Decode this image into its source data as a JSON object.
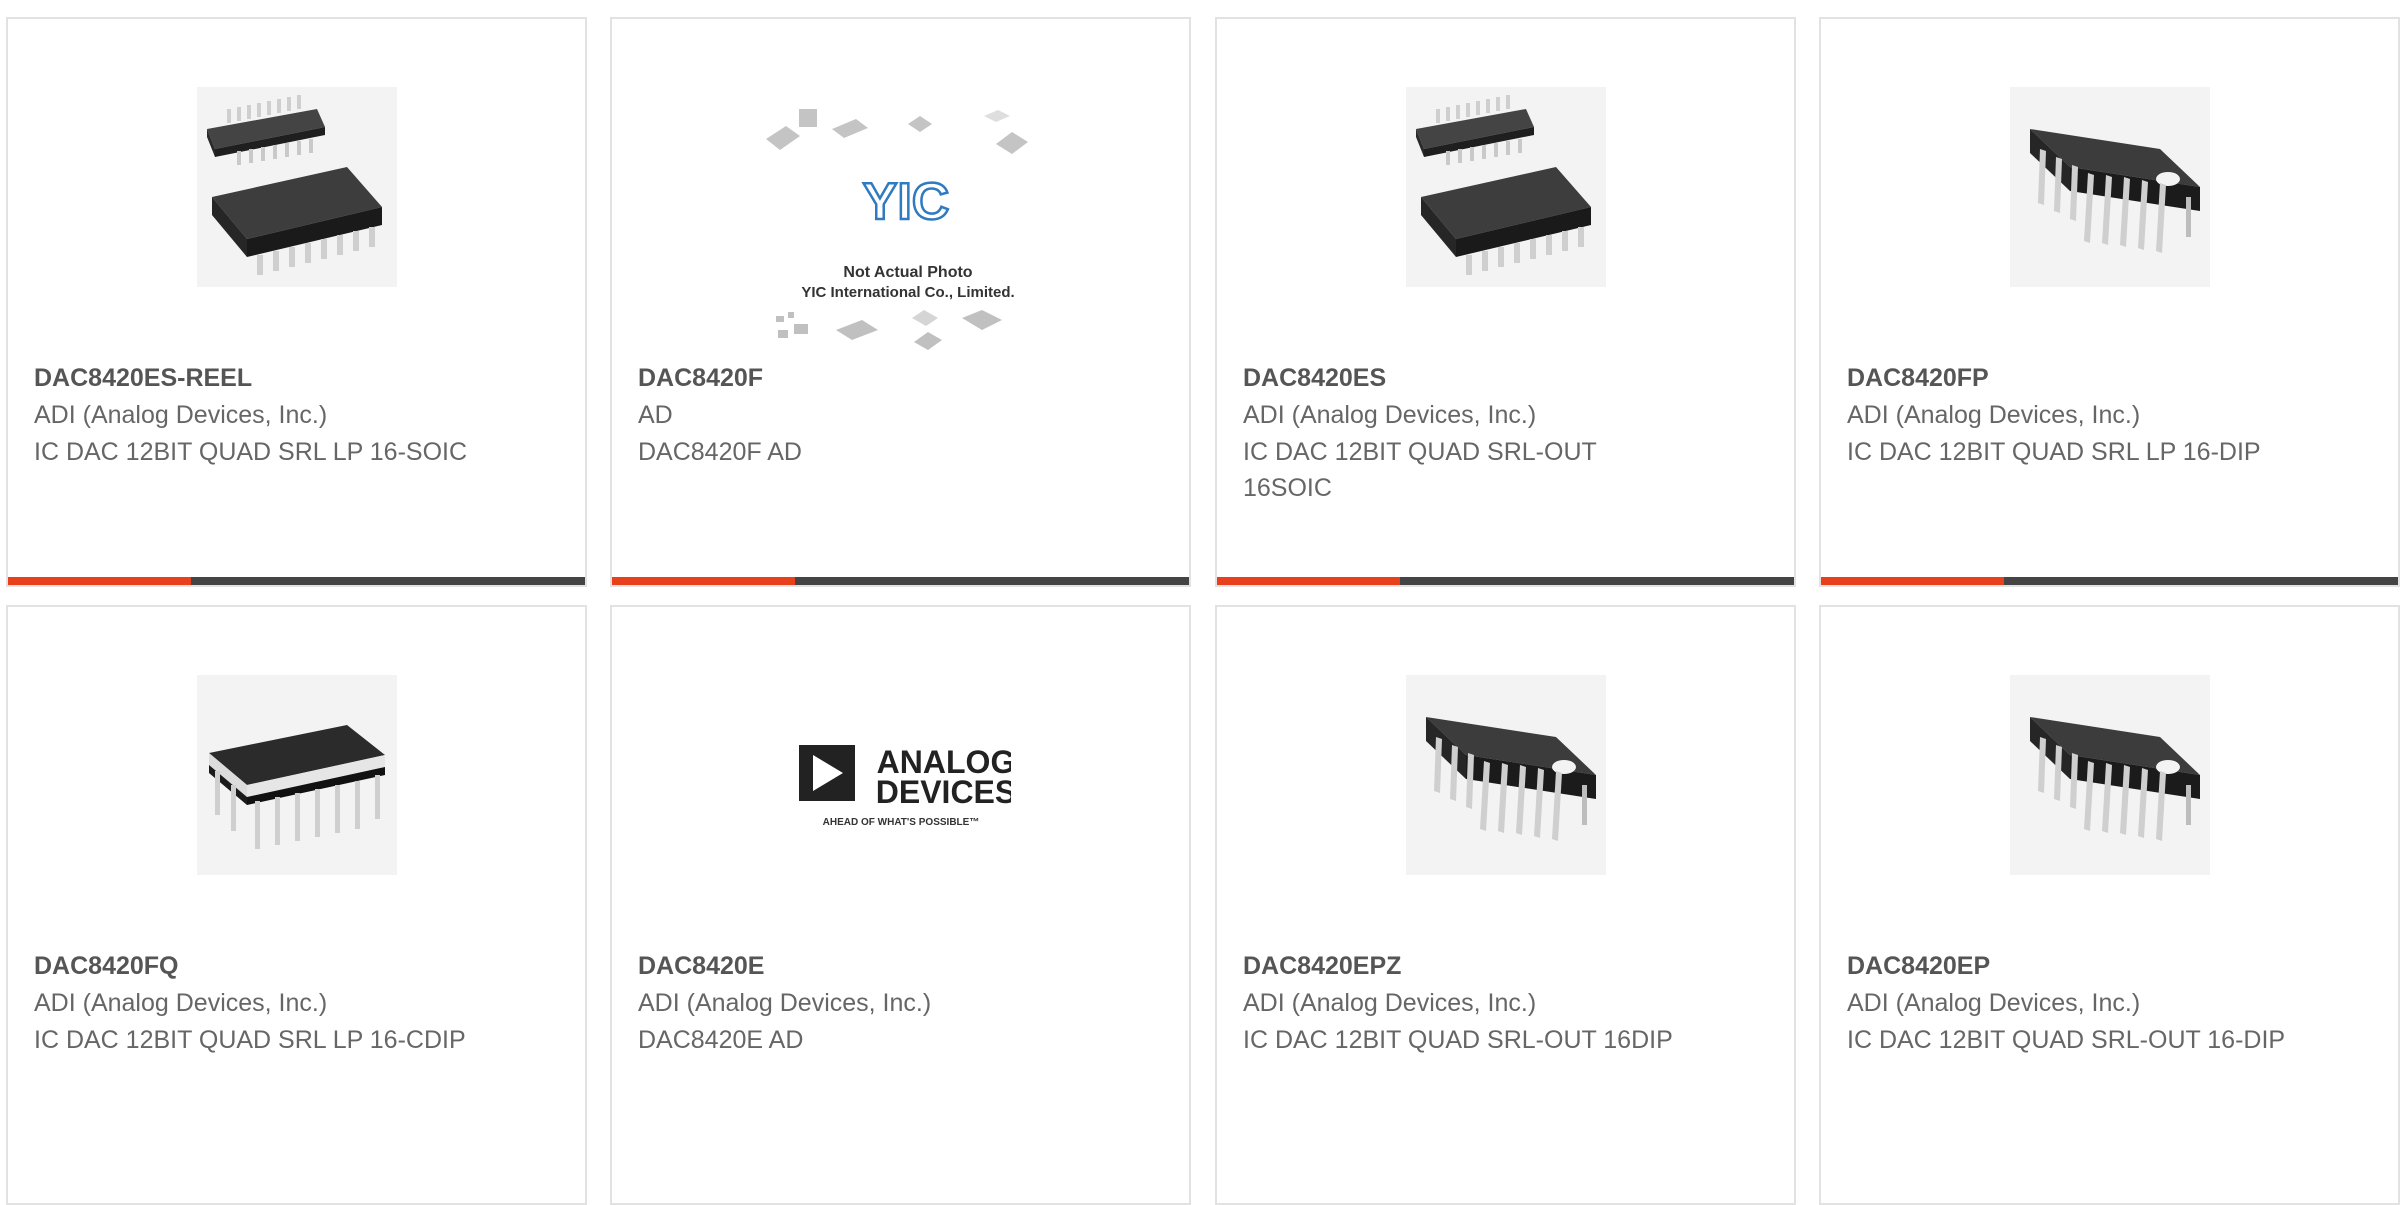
{
  "colors": {
    "accent": "#e8401c",
    "bar": "#444444",
    "part_text": "#555555",
    "body_text": "#666666",
    "card_border": "#e2e2e2"
  },
  "products": [
    {
      "part": "DAC8420ES-REEL",
      "manufacturer": "ADI (Analog Devices, Inc.)",
      "description": "IC DAC 12BIT QUAD SRL LP 16-SOIC",
      "image": "soic-package-icon"
    },
    {
      "part": "DAC8420F",
      "manufacturer": "AD",
      "description": "DAC8420F AD",
      "image": "yic-placeholder-icon",
      "image_text": {
        "logo": "YIC",
        "line1": "Not Actual Photo",
        "line2": "YIC International Co., Limited."
      }
    },
    {
      "part": "DAC8420ES",
      "manufacturer": "ADI (Analog Devices, Inc.)",
      "description": "IC DAC 12BIT QUAD SRL-OUT 16SOIC",
      "image": "soic-package-icon"
    },
    {
      "part": "DAC8420FP",
      "manufacturer": "ADI (Analog Devices, Inc.)",
      "description": "IC DAC 12BIT QUAD SRL LP 16-DIP",
      "image": "dip-package-icon"
    },
    {
      "part": "DAC8420FQ",
      "manufacturer": "ADI (Analog Devices, Inc.)",
      "description": "IC DAC 12BIT QUAD SRL LP 16-CDIP",
      "image": "cdip-package-icon"
    },
    {
      "part": "DAC8420E",
      "manufacturer": "ADI (Analog Devices, Inc.)",
      "description": "DAC8420E AD",
      "image": "analog-devices-logo",
      "image_text": {
        "line1": "ANALOG",
        "line2": "DEVICES",
        "tagline": "AHEAD OF WHAT'S POSSIBLE™"
      }
    },
    {
      "part": "DAC8420EPZ",
      "manufacturer": "ADI (Analog Devices, Inc.)",
      "description": "IC DAC 12BIT QUAD SRL-OUT 16DIP",
      "image": "dip-package-icon"
    },
    {
      "part": "DAC8420EP",
      "manufacturer": "ADI (Analog Devices, Inc.)",
      "description": "IC DAC 12BIT QUAD SRL-OUT 16-DIP",
      "image": "dip-package-icon"
    }
  ]
}
